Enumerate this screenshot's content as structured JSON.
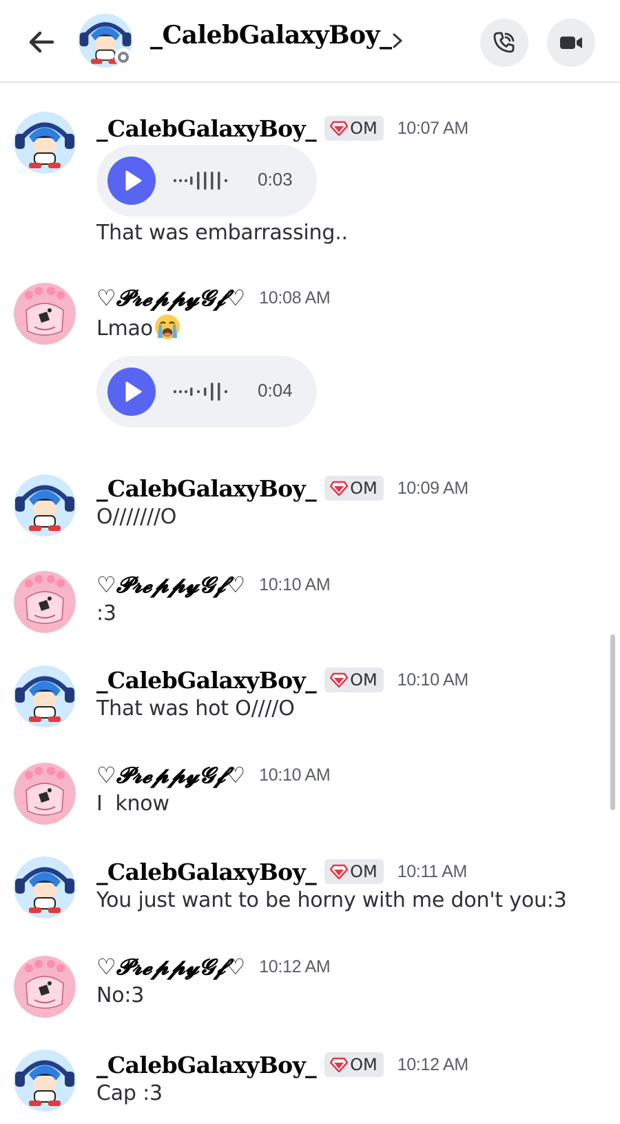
{
  "header": {
    "channel_name": "_CalebGalaxyBoy_",
    "icons": {
      "back": "arrow-left-icon",
      "chevron": "chevron-right-icon",
      "call": "phone-call-icon",
      "video": "video-camera-icon"
    }
  },
  "users": {
    "caleb": {
      "name": "_CalebGalaxyBoy_",
      "badge": "OM",
      "badge_icon": "gem-icon",
      "badge_color": "#e5384a"
    },
    "preppy": {
      "name": "♡𝓟𝓻𝓮𝓹𝓹𝔂𝓖𝓯♡"
    }
  },
  "messages": [
    {
      "user": "caleb",
      "name": "_CalebGalaxyBoy_",
      "badge": "OM",
      "time": "10:07 AM",
      "voice_duration": "0:03",
      "text": "That was embarrassing.."
    },
    {
      "user": "preppy",
      "name": "♡𝓟𝓻𝓮𝓹𝓹𝔂𝓖𝓯♡",
      "time": "10:08 AM",
      "text": "Lmao",
      "emoji": "loudly-crying-face-emoji",
      "voice_duration": "0:04"
    },
    {
      "user": "caleb",
      "name": "_CalebGalaxyBoy_",
      "badge": "OM",
      "time": "10:09 AM",
      "text": "O///////O"
    },
    {
      "user": "preppy",
      "name": "♡𝓟𝓻𝓮𝓹𝓹𝔂𝓖𝓯♡",
      "time": "10:10 AM",
      "text": ":3"
    },
    {
      "user": "caleb",
      "name": "_CalebGalaxyBoy_",
      "badge": "OM",
      "time": "10:10 AM",
      "text": "That was hot O////O"
    },
    {
      "user": "preppy",
      "name": "♡𝓟𝓻𝓮𝓹𝓹𝔂𝓖𝓯♡",
      "time": "10:10 AM",
      "text": "I  know"
    },
    {
      "user": "caleb",
      "name": "_CalebGalaxyBoy_",
      "badge": "OM",
      "time": "10:11 AM",
      "text": "You just want to be horny with me don't you:3"
    },
    {
      "user": "preppy",
      "name": "♡𝓟𝓻𝓮𝓹𝓹𝔂𝓖𝓯♡",
      "time": "10:12 AM",
      "text": "No:3"
    },
    {
      "user": "caleb",
      "name": "_CalebGalaxyBoy_",
      "badge": "OM",
      "time": "10:12 AM",
      "text": "Cap :3"
    }
  ],
  "colors": {
    "accent_play": "#5865f2",
    "badge_gem": "#e5384a",
    "caleb_avatar_bg": "#cfe9ff",
    "preppy_avatar_bg": "#f7b6c8"
  }
}
